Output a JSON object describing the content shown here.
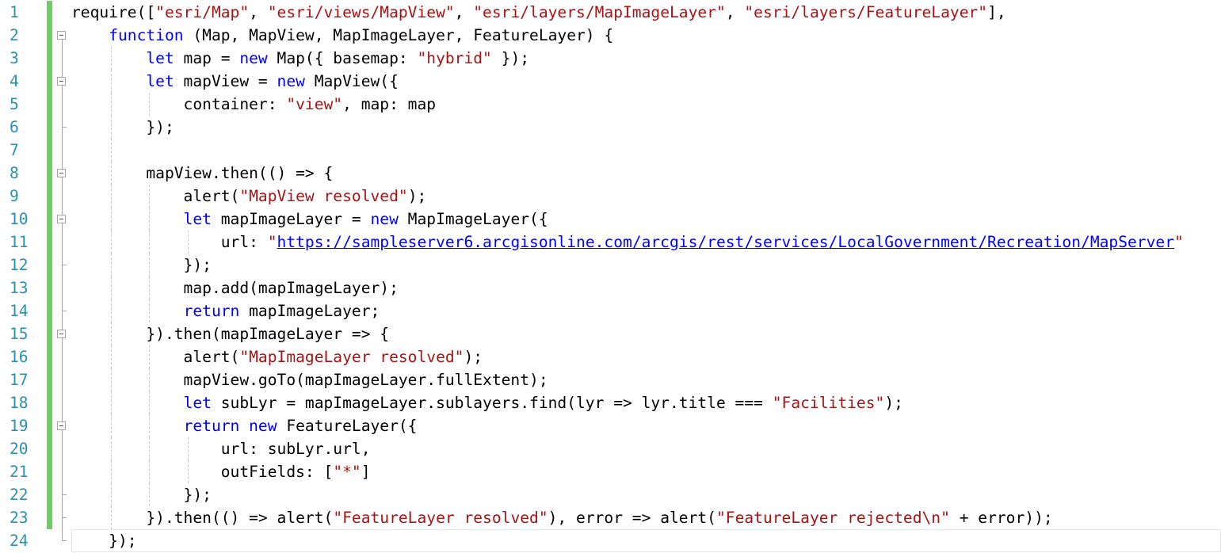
{
  "editor": {
    "colors": {
      "keyword": "#0000ff",
      "string": "#a31515",
      "line_number": "#2b91af",
      "changed_bar": "#6ccf66",
      "text": "#000000"
    },
    "lines": [
      {
        "n": "1",
        "parts": [
          {
            "t": "require([",
            "c": "txt"
          },
          {
            "t": "\"esri/Map\"",
            "c": "str"
          },
          {
            "t": ", ",
            "c": "txt"
          },
          {
            "t": "\"esri/views/MapView\"",
            "c": "str"
          },
          {
            "t": ", ",
            "c": "txt"
          },
          {
            "t": "\"esri/layers/MapImageLayer\"",
            "c": "str"
          },
          {
            "t": ", ",
            "c": "txt"
          },
          {
            "t": "\"esri/layers/FeatureLayer\"",
            "c": "str"
          },
          {
            "t": "],",
            "c": "txt"
          }
        ]
      },
      {
        "n": "2",
        "parts": [
          {
            "t": "    ",
            "c": "txt"
          },
          {
            "t": "function",
            "c": "kw"
          },
          {
            "t": " (Map, MapView, MapImageLayer, FeatureLayer) {",
            "c": "txt"
          }
        ]
      },
      {
        "n": "3",
        "parts": [
          {
            "t": "        ",
            "c": "txt"
          },
          {
            "t": "let",
            "c": "kw"
          },
          {
            "t": " map = ",
            "c": "txt"
          },
          {
            "t": "new",
            "c": "kw"
          },
          {
            "t": " Map({ basemap: ",
            "c": "txt"
          },
          {
            "t": "\"hybrid\"",
            "c": "str"
          },
          {
            "t": " });",
            "c": "txt"
          }
        ]
      },
      {
        "n": "4",
        "parts": [
          {
            "t": "        ",
            "c": "txt"
          },
          {
            "t": "let",
            "c": "kw"
          },
          {
            "t": " mapView = ",
            "c": "txt"
          },
          {
            "t": "new",
            "c": "kw"
          },
          {
            "t": " MapView({",
            "c": "txt"
          }
        ]
      },
      {
        "n": "5",
        "parts": [
          {
            "t": "            container: ",
            "c": "txt"
          },
          {
            "t": "\"view\"",
            "c": "str"
          },
          {
            "t": ", map: map",
            "c": "txt"
          }
        ]
      },
      {
        "n": "6",
        "parts": [
          {
            "t": "        });",
            "c": "txt"
          }
        ]
      },
      {
        "n": "7",
        "parts": []
      },
      {
        "n": "8",
        "parts": [
          {
            "t": "        mapView.then(() => {",
            "c": "txt"
          }
        ]
      },
      {
        "n": "9",
        "parts": [
          {
            "t": "            alert(",
            "c": "txt"
          },
          {
            "t": "\"MapView resolved\"",
            "c": "str"
          },
          {
            "t": ");",
            "c": "txt"
          }
        ]
      },
      {
        "n": "10",
        "parts": [
          {
            "t": "            ",
            "c": "txt"
          },
          {
            "t": "let",
            "c": "kw"
          },
          {
            "t": " mapImageLayer = ",
            "c": "txt"
          },
          {
            "t": "new",
            "c": "kw"
          },
          {
            "t": " MapImageLayer({",
            "c": "txt"
          }
        ]
      },
      {
        "n": "11",
        "parts": [
          {
            "t": "                url: ",
            "c": "txt"
          },
          {
            "t": "\"",
            "c": "str"
          },
          {
            "t": "https://sampleserver6.arcgisonline.com/arcgis/rest/services/LocalGovernment/Recreation/MapServer",
            "c": "url"
          },
          {
            "t": "\"",
            "c": "str"
          }
        ]
      },
      {
        "n": "12",
        "parts": [
          {
            "t": "            });",
            "c": "txt"
          }
        ]
      },
      {
        "n": "13",
        "parts": [
          {
            "t": "            map.add(mapImageLayer);",
            "c": "txt"
          }
        ]
      },
      {
        "n": "14",
        "parts": [
          {
            "t": "            ",
            "c": "txt"
          },
          {
            "t": "return",
            "c": "kw"
          },
          {
            "t": " mapImageLayer;",
            "c": "txt"
          }
        ]
      },
      {
        "n": "15",
        "parts": [
          {
            "t": "        }).then(mapImageLayer => {",
            "c": "txt"
          }
        ]
      },
      {
        "n": "16",
        "parts": [
          {
            "t": "            alert(",
            "c": "txt"
          },
          {
            "t": "\"MapImageLayer resolved\"",
            "c": "str"
          },
          {
            "t": ");",
            "c": "txt"
          }
        ]
      },
      {
        "n": "17",
        "parts": [
          {
            "t": "            mapView.goTo(mapImageLayer.fullExtent);",
            "c": "txt"
          }
        ]
      },
      {
        "n": "18",
        "parts": [
          {
            "t": "            ",
            "c": "txt"
          },
          {
            "t": "let",
            "c": "kw"
          },
          {
            "t": " subLyr = mapImageLayer.sublayers.find(lyr => lyr.title === ",
            "c": "txt"
          },
          {
            "t": "\"Facilities\"",
            "c": "str"
          },
          {
            "t": ");",
            "c": "txt"
          }
        ]
      },
      {
        "n": "19",
        "parts": [
          {
            "t": "            ",
            "c": "txt"
          },
          {
            "t": "return",
            "c": "kw"
          },
          {
            "t": " ",
            "c": "txt"
          },
          {
            "t": "new",
            "c": "kw"
          },
          {
            "t": " FeatureLayer({",
            "c": "txt"
          }
        ]
      },
      {
        "n": "20",
        "parts": [
          {
            "t": "                url: subLyr.url,",
            "c": "txt"
          }
        ]
      },
      {
        "n": "21",
        "parts": [
          {
            "t": "                outFields: [",
            "c": "txt"
          },
          {
            "t": "\"*\"",
            "c": "str"
          },
          {
            "t": "]",
            "c": "txt"
          }
        ]
      },
      {
        "n": "22",
        "parts": [
          {
            "t": "            });",
            "c": "txt"
          }
        ]
      },
      {
        "n": "23",
        "parts": [
          {
            "t": "        }).then(() => alert(",
            "c": "txt"
          },
          {
            "t": "\"FeatureLayer resolved\"",
            "c": "str"
          },
          {
            "t": "), error => alert(",
            "c": "txt"
          },
          {
            "t": "\"FeatureLayer rejected\\n\"",
            "c": "str"
          },
          {
            "t": " + error));",
            "c": "txt"
          }
        ]
      },
      {
        "n": "24",
        "parts": [
          {
            "t": "    });",
            "c": "txt"
          }
        ]
      }
    ]
  }
}
